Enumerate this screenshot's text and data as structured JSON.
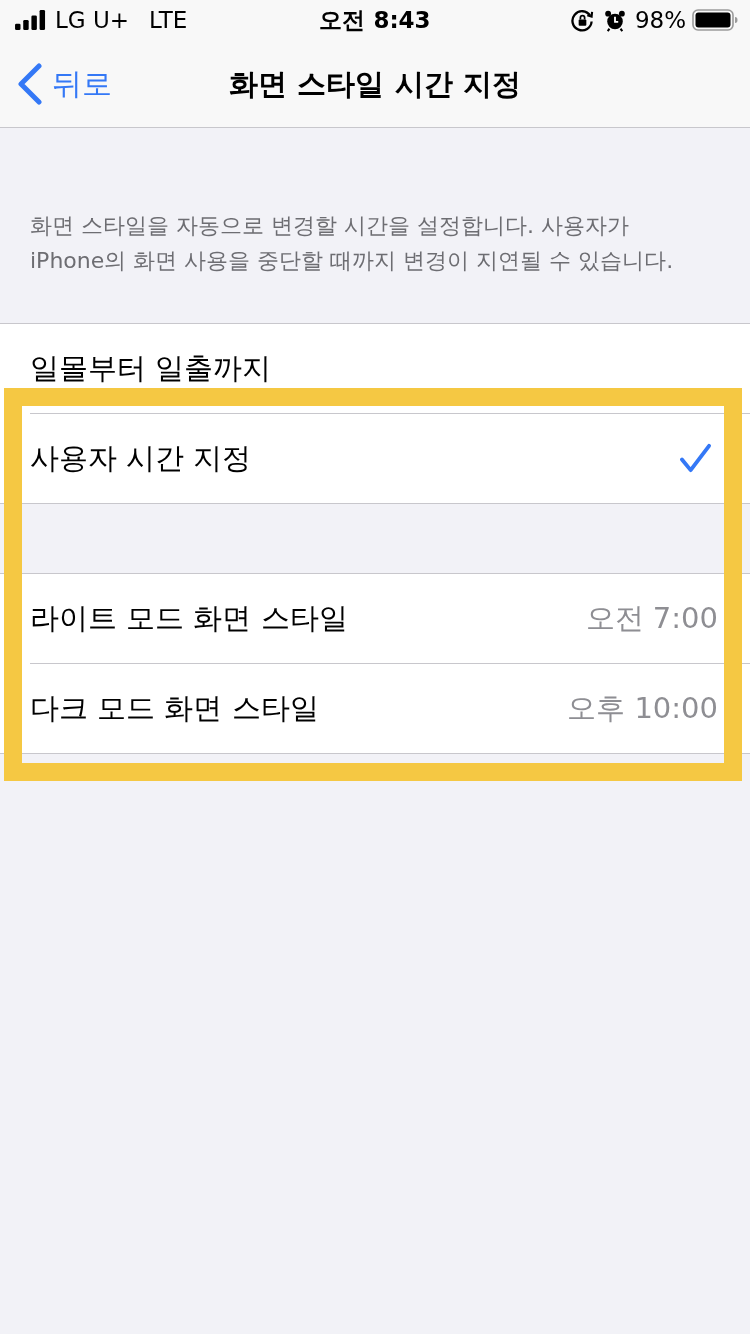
{
  "status_bar": {
    "carrier": "LG U+",
    "network": "LTE",
    "time": "오전 8:43",
    "battery_percent": "98%"
  },
  "nav_bar": {
    "back_label": "뒤로",
    "title": "화면 스타일 시간 지정"
  },
  "description": "화면 스타일을 자동으로 변경할 시간을 설정합니다. 사용자가 iPhone의 화면 사용을 중단할 때까지 변경이 지연될 수 있습니다.",
  "schedule_options": [
    {
      "label": "일몰부터 일출까지",
      "selected": false
    },
    {
      "label": "사용자 시간 지정",
      "selected": true
    }
  ],
  "custom_times": [
    {
      "label": "라이트 모드 화면 스타일",
      "value": "오전 7:00"
    },
    {
      "label": "다크 모드 화면 스타일",
      "value": "오후 10:00"
    }
  ],
  "annotation": {
    "kind": "highlight-frame"
  }
}
